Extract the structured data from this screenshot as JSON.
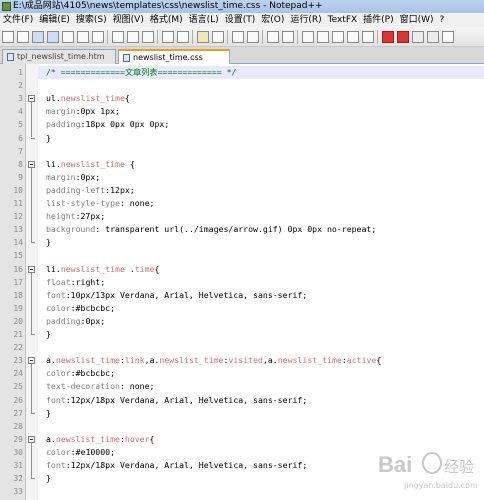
{
  "window": {
    "title": "E:\\成品网站\\4105\\news\\templates\\css\\newslist_time.css - Notepad++"
  },
  "menu": [
    "文件(F)",
    "编辑(E)",
    "搜索(S)",
    "视图(V)",
    "格式(M)",
    "语言(L)",
    "设置(T)",
    "宏(O)",
    "运行(R)",
    "TextFX",
    "插件(P)",
    "窗口(W)",
    "?"
  ],
  "toolbar_icons": [
    "new-file-icon",
    "open-file-icon",
    "save-icon",
    "save-all-icon",
    "close-icon",
    "close-all-icon",
    "print-icon",
    "cut-icon",
    "copy-icon",
    "paste-icon",
    "undo-icon",
    "redo-icon",
    "find-icon",
    "replace-icon",
    "zoom-in-icon",
    "zoom-out-icon",
    "sync-v-icon",
    "sync-h-icon",
    "wrap-icon",
    "show-all-icon",
    "indent-guide-icon",
    "user-lang-icon",
    "doc-map-icon",
    "record-icon",
    "stop-icon",
    "play-icon",
    "play-multi-icon",
    "save-macro-icon"
  ],
  "tabs": [
    {
      "label": "tpl_newslist_time.htm",
      "active": false
    },
    {
      "label": "newslist_time.css",
      "active": true
    }
  ],
  "code_lines": [
    {
      "n": "1",
      "segs": [
        {
          "t": "/* =============文章列表============= */",
          "c": "comment"
        }
      ]
    },
    {
      "n": "2",
      "segs": []
    },
    {
      "n": "3",
      "segs": [
        {
          "t": "ul.",
          "c": "sel"
        },
        {
          "t": "newslist_time",
          "c": "cls"
        },
        {
          "t": "{",
          "c": "sel"
        }
      ]
    },
    {
      "n": "4",
      "segs": [
        {
          "t": "margin",
          "c": "prop"
        },
        {
          "t": ":0px 1px;",
          "c": "val"
        }
      ]
    },
    {
      "n": "5",
      "segs": [
        {
          "t": "padding",
          "c": "prop"
        },
        {
          "t": ":18px 0px 0px 0px;",
          "c": "val"
        }
      ]
    },
    {
      "n": "6",
      "segs": [
        {
          "t": "}",
          "c": "sel"
        }
      ]
    },
    {
      "n": "7",
      "segs": []
    },
    {
      "n": "8",
      "segs": [
        {
          "t": "li.",
          "c": "sel"
        },
        {
          "t": "newslist_time",
          "c": "cls"
        },
        {
          "t": " {",
          "c": "sel"
        }
      ]
    },
    {
      "n": "9",
      "segs": [
        {
          "t": "margin",
          "c": "prop"
        },
        {
          "t": ":0px;",
          "c": "val"
        }
      ]
    },
    {
      "n": "10",
      "segs": [
        {
          "t": "padding-left",
          "c": "prop"
        },
        {
          "t": ":12px;",
          "c": "val"
        }
      ]
    },
    {
      "n": "11",
      "segs": [
        {
          "t": "list-style-type",
          "c": "prop"
        },
        {
          "t": ": none;",
          "c": "val"
        }
      ]
    },
    {
      "n": "12",
      "segs": [
        {
          "t": "height",
          "c": "prop"
        },
        {
          "t": ":27px;",
          "c": "val"
        }
      ]
    },
    {
      "n": "13",
      "segs": [
        {
          "t": "background",
          "c": "prop"
        },
        {
          "t": ": transparent url(../images/arrow.gif) 0px 0px no-repeat;",
          "c": "val"
        }
      ]
    },
    {
      "n": "14",
      "segs": [
        {
          "t": "}",
          "c": "sel"
        }
      ]
    },
    {
      "n": "15",
      "segs": []
    },
    {
      "n": "16",
      "segs": [
        {
          "t": "li.",
          "c": "sel"
        },
        {
          "t": "newslist_time",
          "c": "cls"
        },
        {
          "t": " .",
          "c": "sel"
        },
        {
          "t": "time",
          "c": "cls"
        },
        {
          "t": "{",
          "c": "sel"
        }
      ]
    },
    {
      "n": "17",
      "segs": [
        {
          "t": "float",
          "c": "prop"
        },
        {
          "t": ":right;",
          "c": "val"
        }
      ]
    },
    {
      "n": "18",
      "segs": [
        {
          "t": "font",
          "c": "prop"
        },
        {
          "t": ":10px/13px Verdana, Arial, Helvetica, sans-serif;",
          "c": "val"
        }
      ]
    },
    {
      "n": "19",
      "segs": [
        {
          "t": "color",
          "c": "prop"
        },
        {
          "t": ":#bcbcbc;",
          "c": "val"
        }
      ]
    },
    {
      "n": "20",
      "segs": [
        {
          "t": "padding",
          "c": "prop"
        },
        {
          "t": ":0px;",
          "c": "val"
        }
      ]
    },
    {
      "n": "21",
      "segs": [
        {
          "t": "}",
          "c": "sel"
        }
      ]
    },
    {
      "n": "22",
      "segs": []
    },
    {
      "n": "23",
      "segs": [
        {
          "t": "a.",
          "c": "sel"
        },
        {
          "t": "newslist_time",
          "c": "cls"
        },
        {
          "t": ":",
          "c": "sel"
        },
        {
          "t": "link",
          "c": "cls"
        },
        {
          "t": ",a.",
          "c": "sel"
        },
        {
          "t": "newslist_time",
          "c": "cls"
        },
        {
          "t": ":",
          "c": "sel"
        },
        {
          "t": "visited",
          "c": "cls"
        },
        {
          "t": ",a.",
          "c": "sel"
        },
        {
          "t": "newslist_time",
          "c": "cls"
        },
        {
          "t": ":",
          "c": "sel"
        },
        {
          "t": "active",
          "c": "cls"
        },
        {
          "t": "{",
          "c": "sel"
        }
      ]
    },
    {
      "n": "24",
      "segs": [
        {
          "t": "color",
          "c": "prop"
        },
        {
          "t": ":#bcbcbc;",
          "c": "val"
        }
      ]
    },
    {
      "n": "25",
      "segs": [
        {
          "t": "text-decoration",
          "c": "prop"
        },
        {
          "t": ": none;",
          "c": "val"
        }
      ]
    },
    {
      "n": "26",
      "segs": [
        {
          "t": "font",
          "c": "prop"
        },
        {
          "t": ":12px/18px Verdana, Arial, Helvetica, sans-serif;",
          "c": "val"
        }
      ]
    },
    {
      "n": "27",
      "segs": [
        {
          "t": "}",
          "c": "sel"
        }
      ]
    },
    {
      "n": "28",
      "segs": []
    },
    {
      "n": "29",
      "segs": [
        {
          "t": "a.",
          "c": "sel"
        },
        {
          "t": "newslist_time",
          "c": "cls"
        },
        {
          "t": ":",
          "c": "sel"
        },
        {
          "t": "hover",
          "c": "cls"
        },
        {
          "t": "{",
          "c": "sel"
        }
      ]
    },
    {
      "n": "30",
      "segs": [
        {
          "t": "color",
          "c": "prop"
        },
        {
          "t": ":#e10000;",
          "c": "val"
        }
      ]
    },
    {
      "n": "31",
      "segs": [
        {
          "t": "font",
          "c": "prop"
        },
        {
          "t": ":12px/18px Verdana, Arial, Helvetica, sans-serif;",
          "c": "val"
        }
      ]
    },
    {
      "n": "32",
      "segs": [
        {
          "t": "}",
          "c": "sel"
        }
      ]
    },
    {
      "n": "33",
      "segs": []
    }
  ],
  "fold_blocks": [
    [
      3,
      6
    ],
    [
      8,
      14
    ],
    [
      16,
      21
    ],
    [
      23,
      27
    ],
    [
      29,
      32
    ]
  ],
  "colors": {
    "comment": "#008000",
    "selector": "#000000",
    "class": "#cc6f6f",
    "property": "#7f7f7f",
    "value": "#000000",
    "active_tab_accent": "#f39c1e"
  },
  "watermark": {
    "text": "Bai",
    "suffix": "经验",
    "sub": "jingyan.baidu.com"
  }
}
